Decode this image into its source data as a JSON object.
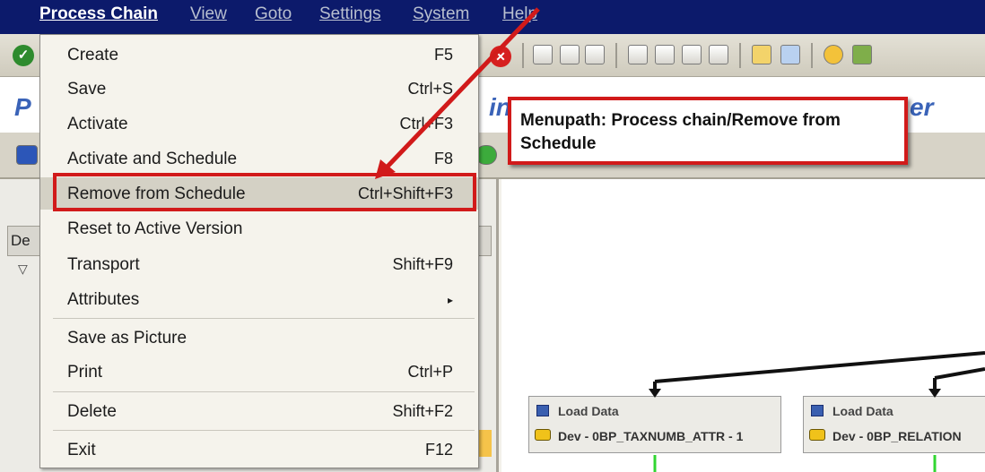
{
  "menubar": {
    "items": [
      "Process Chain",
      "View",
      "Goto",
      "Settings",
      "System",
      "Help"
    ]
  },
  "title": {
    "frag_left": "P",
    "frag_mid": "in",
    "frag_right": "er"
  },
  "left_pane": {
    "column_header": "De"
  },
  "menu": {
    "items": [
      {
        "label": "Create",
        "shortcut": "F5"
      },
      {
        "label": "Save",
        "shortcut": "Ctrl+S"
      },
      {
        "label": "Activate",
        "shortcut": "Ctrl+F3"
      },
      {
        "label": "Activate and Schedule",
        "shortcut": "F8"
      },
      {
        "label": "Remove from Schedule",
        "shortcut": "Ctrl+Shift+F3"
      },
      {
        "label": "Reset to Active Version",
        "shortcut": ""
      },
      {
        "label": "Transport",
        "shortcut": "Shift+F9"
      },
      {
        "label": "Attributes",
        "shortcut": "▸"
      },
      {
        "label": "Save as Picture",
        "shortcut": ""
      },
      {
        "label": "Print",
        "shortcut": "Ctrl+P"
      },
      {
        "label": "Delete",
        "shortcut": "Shift+F2"
      },
      {
        "label": "Exit",
        "shortcut": "F12"
      }
    ]
  },
  "callout": {
    "text": "Menupath: Process chain/Remove from Schedule"
  },
  "nodes": [
    {
      "title": "Load Data",
      "sub": "Dev - 0BP_TAXNUMB_ATTR - 1"
    },
    {
      "title": "Load Data",
      "sub": "Dev - 0BP_RELATION"
    }
  ],
  "colors": {
    "menubar": "#0c1a6b",
    "highlight": "#d11a1a",
    "connector_green": "#31d631"
  }
}
